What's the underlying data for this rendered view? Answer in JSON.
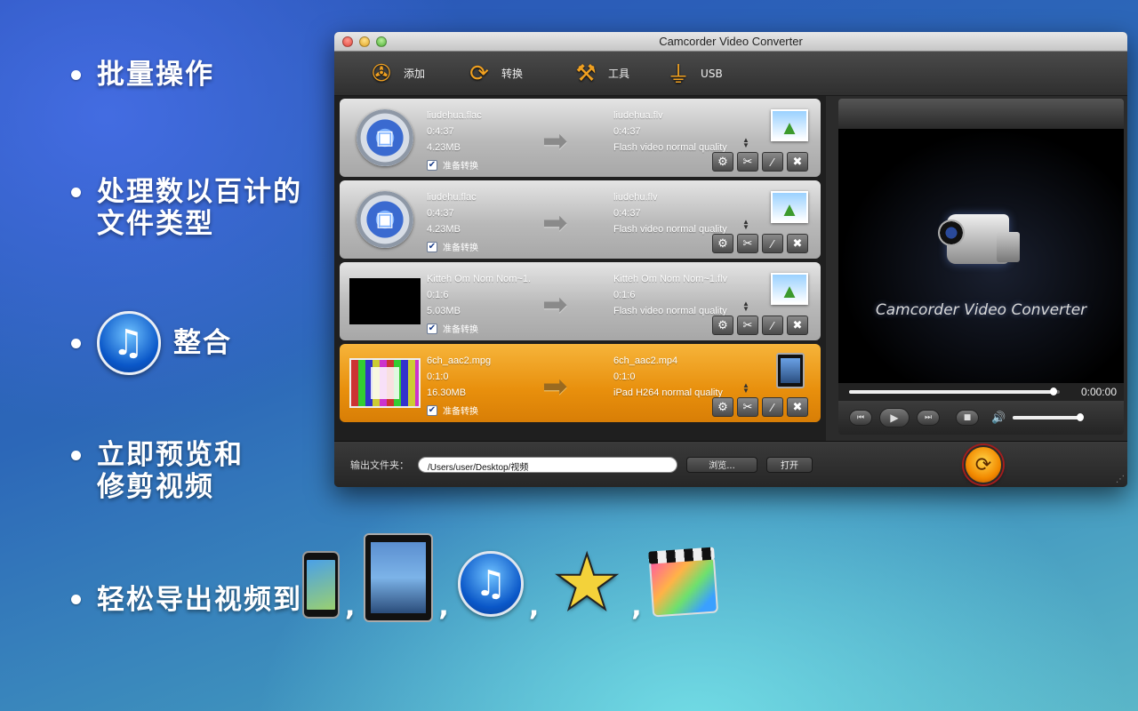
{
  "features": {
    "batch": "批量操作",
    "types_line1": "处理数以百计的",
    "types_line2": "文件类型",
    "integrate": "整合",
    "preview_line1": "立即预览和",
    "preview_line2": "修剪视频",
    "export": "轻松导出视频到",
    "comma": ","
  },
  "window": {
    "title": "Camcorder Video Converter"
  },
  "toolbar": {
    "add_label": "添加",
    "convert_label": "转换",
    "tools_label": "工具",
    "usb_label": "USB"
  },
  "files": [
    {
      "src_name": "liudehua.flac",
      "src_duration": "0:4:37",
      "src_size": "4.23MB",
      "dst_name": "liudehua.flv",
      "dst_duration": "0:4:37",
      "dst_quality": "Flash video normal quality",
      "status": "准备转换",
      "checked": true
    },
    {
      "src_name": "liudehu.flac",
      "src_duration": "0:4:37",
      "src_size": "4.23MB",
      "dst_name": "liudehu.flv",
      "dst_duration": "0:4:37",
      "dst_quality": "Flash video normal quality",
      "status": "准备转换",
      "checked": true
    },
    {
      "src_name": "Kitteh Om Nom Nom~1.",
      "src_duration": "0:1:6",
      "src_size": "5.03MB",
      "dst_name": "Kitteh Om Nom Nom~1.flv",
      "dst_duration": "0:1:6",
      "dst_quality": "Flash video normal quality",
      "status": "准备转换",
      "checked": true
    },
    {
      "src_name": "6ch_aac2.mpg",
      "src_duration": "0:1:0",
      "src_size": "16.30MB",
      "dst_name": "6ch_aac2.mp4",
      "dst_duration": "0:1:0",
      "dst_quality": "iPad H264 normal quality",
      "status": "准备转换",
      "checked": true,
      "selected": true
    }
  ],
  "player": {
    "brand": "Camcorder Video Converter",
    "timecode": "0:00:00",
    "seek_fraction": 0.97,
    "volume_fraction": 0.95
  },
  "output": {
    "label": "输出文件夹：",
    "path": "/Users/user/Desktop/视频",
    "browse_label": "浏览...",
    "open_label": "打开"
  },
  "colors": {
    "selected_row": "#e88f0c",
    "accent": "#f0a020"
  }
}
